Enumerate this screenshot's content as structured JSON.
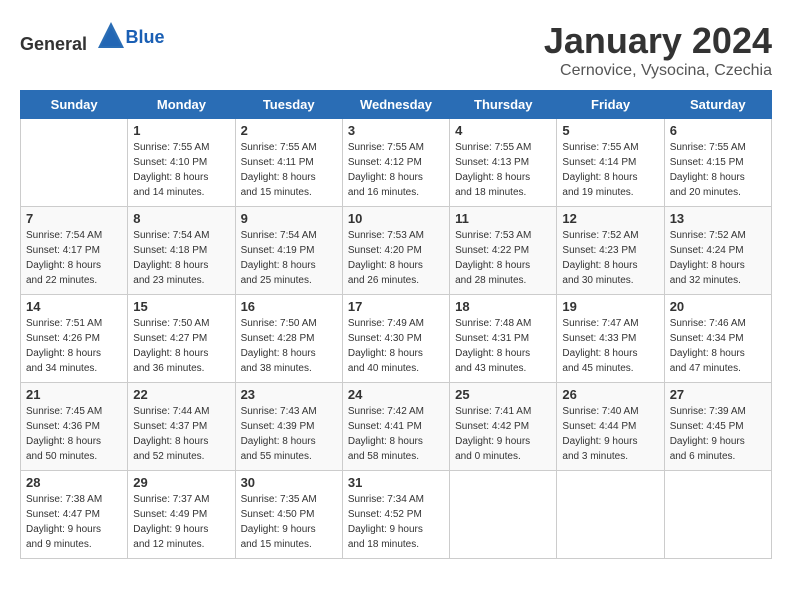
{
  "header": {
    "logo_general": "General",
    "logo_blue": "Blue",
    "month": "January 2024",
    "location": "Cernovice, Vysocina, Czechia"
  },
  "days_of_week": [
    "Sunday",
    "Monday",
    "Tuesday",
    "Wednesday",
    "Thursday",
    "Friday",
    "Saturday"
  ],
  "weeks": [
    [
      {
        "day": "",
        "info": ""
      },
      {
        "day": "1",
        "info": "Sunrise: 7:55 AM\nSunset: 4:10 PM\nDaylight: 8 hours\nand 14 minutes."
      },
      {
        "day": "2",
        "info": "Sunrise: 7:55 AM\nSunset: 4:11 PM\nDaylight: 8 hours\nand 15 minutes."
      },
      {
        "day": "3",
        "info": "Sunrise: 7:55 AM\nSunset: 4:12 PM\nDaylight: 8 hours\nand 16 minutes."
      },
      {
        "day": "4",
        "info": "Sunrise: 7:55 AM\nSunset: 4:13 PM\nDaylight: 8 hours\nand 18 minutes."
      },
      {
        "day": "5",
        "info": "Sunrise: 7:55 AM\nSunset: 4:14 PM\nDaylight: 8 hours\nand 19 minutes."
      },
      {
        "day": "6",
        "info": "Sunrise: 7:55 AM\nSunset: 4:15 PM\nDaylight: 8 hours\nand 20 minutes."
      }
    ],
    [
      {
        "day": "7",
        "info": "Sunrise: 7:54 AM\nSunset: 4:17 PM\nDaylight: 8 hours\nand 22 minutes."
      },
      {
        "day": "8",
        "info": "Sunrise: 7:54 AM\nSunset: 4:18 PM\nDaylight: 8 hours\nand 23 minutes."
      },
      {
        "day": "9",
        "info": "Sunrise: 7:54 AM\nSunset: 4:19 PM\nDaylight: 8 hours\nand 25 minutes."
      },
      {
        "day": "10",
        "info": "Sunrise: 7:53 AM\nSunset: 4:20 PM\nDaylight: 8 hours\nand 26 minutes."
      },
      {
        "day": "11",
        "info": "Sunrise: 7:53 AM\nSunset: 4:22 PM\nDaylight: 8 hours\nand 28 minutes."
      },
      {
        "day": "12",
        "info": "Sunrise: 7:52 AM\nSunset: 4:23 PM\nDaylight: 8 hours\nand 30 minutes."
      },
      {
        "day": "13",
        "info": "Sunrise: 7:52 AM\nSunset: 4:24 PM\nDaylight: 8 hours\nand 32 minutes."
      }
    ],
    [
      {
        "day": "14",
        "info": "Sunrise: 7:51 AM\nSunset: 4:26 PM\nDaylight: 8 hours\nand 34 minutes."
      },
      {
        "day": "15",
        "info": "Sunrise: 7:50 AM\nSunset: 4:27 PM\nDaylight: 8 hours\nand 36 minutes."
      },
      {
        "day": "16",
        "info": "Sunrise: 7:50 AM\nSunset: 4:28 PM\nDaylight: 8 hours\nand 38 minutes."
      },
      {
        "day": "17",
        "info": "Sunrise: 7:49 AM\nSunset: 4:30 PM\nDaylight: 8 hours\nand 40 minutes."
      },
      {
        "day": "18",
        "info": "Sunrise: 7:48 AM\nSunset: 4:31 PM\nDaylight: 8 hours\nand 43 minutes."
      },
      {
        "day": "19",
        "info": "Sunrise: 7:47 AM\nSunset: 4:33 PM\nDaylight: 8 hours\nand 45 minutes."
      },
      {
        "day": "20",
        "info": "Sunrise: 7:46 AM\nSunset: 4:34 PM\nDaylight: 8 hours\nand 47 minutes."
      }
    ],
    [
      {
        "day": "21",
        "info": "Sunrise: 7:45 AM\nSunset: 4:36 PM\nDaylight: 8 hours\nand 50 minutes."
      },
      {
        "day": "22",
        "info": "Sunrise: 7:44 AM\nSunset: 4:37 PM\nDaylight: 8 hours\nand 52 minutes."
      },
      {
        "day": "23",
        "info": "Sunrise: 7:43 AM\nSunset: 4:39 PM\nDaylight: 8 hours\nand 55 minutes."
      },
      {
        "day": "24",
        "info": "Sunrise: 7:42 AM\nSunset: 4:41 PM\nDaylight: 8 hours\nand 58 minutes."
      },
      {
        "day": "25",
        "info": "Sunrise: 7:41 AM\nSunset: 4:42 PM\nDaylight: 9 hours\nand 0 minutes."
      },
      {
        "day": "26",
        "info": "Sunrise: 7:40 AM\nSunset: 4:44 PM\nDaylight: 9 hours\nand 3 minutes."
      },
      {
        "day": "27",
        "info": "Sunrise: 7:39 AM\nSunset: 4:45 PM\nDaylight: 9 hours\nand 6 minutes."
      }
    ],
    [
      {
        "day": "28",
        "info": "Sunrise: 7:38 AM\nSunset: 4:47 PM\nDaylight: 9 hours\nand 9 minutes."
      },
      {
        "day": "29",
        "info": "Sunrise: 7:37 AM\nSunset: 4:49 PM\nDaylight: 9 hours\nand 12 minutes."
      },
      {
        "day": "30",
        "info": "Sunrise: 7:35 AM\nSunset: 4:50 PM\nDaylight: 9 hours\nand 15 minutes."
      },
      {
        "day": "31",
        "info": "Sunrise: 7:34 AM\nSunset: 4:52 PM\nDaylight: 9 hours\nand 18 minutes."
      },
      {
        "day": "",
        "info": ""
      },
      {
        "day": "",
        "info": ""
      },
      {
        "day": "",
        "info": ""
      }
    ]
  ]
}
